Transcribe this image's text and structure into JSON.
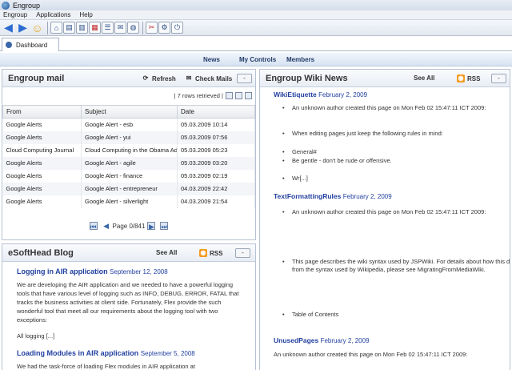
{
  "window": {
    "title": "Engroup"
  },
  "menu": [
    "Engroup",
    "Applications",
    "Help"
  ],
  "tabs": [
    {
      "label": "Dashboard"
    }
  ],
  "nav": [
    "News",
    "My Controls",
    "Members"
  ],
  "mail": {
    "title": "Engroup mail",
    "refresh": "Refresh",
    "check": "Check Mails",
    "rows_info": "| 7 rows retrieved |",
    "columns": [
      "From",
      "Subject",
      "Date"
    ],
    "rows": [
      [
        "Google Alerts",
        "Google Alert - esb",
        "05.03.2009 10:14"
      ],
      [
        "Google Alerts",
        "Google Alert - yui",
        "05.03.2009 07:56"
      ],
      [
        "Cloud Computing Journal",
        "Cloud Computing in the Obama Administration",
        "05.03.2009 05:23"
      ],
      [
        "Google Alerts",
        "Google Alert - agile",
        "05.03.2009 03:20"
      ],
      [
        "Google Alerts",
        "Google Alert - finance",
        "05.03.2009 02:19"
      ],
      [
        "Google Alerts",
        "Google Alert - entrepreneur",
        "04.03.2009 22:42"
      ],
      [
        "Google Alerts",
        "Google Alert - silverlight",
        "04.03.2009 21:54"
      ]
    ],
    "page": "Page 0/841"
  },
  "blog": {
    "title": "eSoftHead Blog",
    "see_all": "See All",
    "rss": "RSS",
    "posts": [
      {
        "title": "Logging in AIR application",
        "date": "September 12, 2008",
        "body": "We are developing the AIR application and we needed to have a powerful logging tools that have various level of logging such as INFO, DEBUG, ERROR, FATAL that tracks the business activities at client side. Fortunately, Flex provide the such wonderful tool that meet all our requirements about the logging tool with two exceptions:",
        "more": "All logging [...]"
      },
      {
        "title": "Loading Modules in AIR application",
        "date": "September 5, 2008",
        "body": "We had the task-force of loading Flex modules in AIR application at"
      }
    ]
  },
  "wiki": {
    "title": "Engroup Wiki News",
    "see_all": "See All",
    "rss": "RSS",
    "entries": [
      {
        "title": "WikiEtiquette",
        "date": "February 2, 2009",
        "items": [
          "An unknown author created this page on Mon Feb 02 15:47:11 ICT 2009:",
          "When editing pages just keep the following rules in mind:",
          "General#",
          "Be gentle - don't be rude or offensive.",
          "Wr[...]"
        ]
      },
      {
        "title": "TextFormattingRules",
        "date": "February 2, 2009",
        "items": [
          "An unknown author created this page on Mon Feb 02 15:47:11 ICT 2009:",
          "This page describes the wiki syntax used by JSPWiki. For details about how this differs from the syntax used by Wikipedia, please see MigratingFromMediaWiki.",
          "Table of Contents"
        ]
      },
      {
        "title": "UnusedPages",
        "date": "February 2, 2009",
        "text": "An unknown author created this page on Mon Feb 02 15:47:11 ICT 2009:"
      }
    ]
  }
}
